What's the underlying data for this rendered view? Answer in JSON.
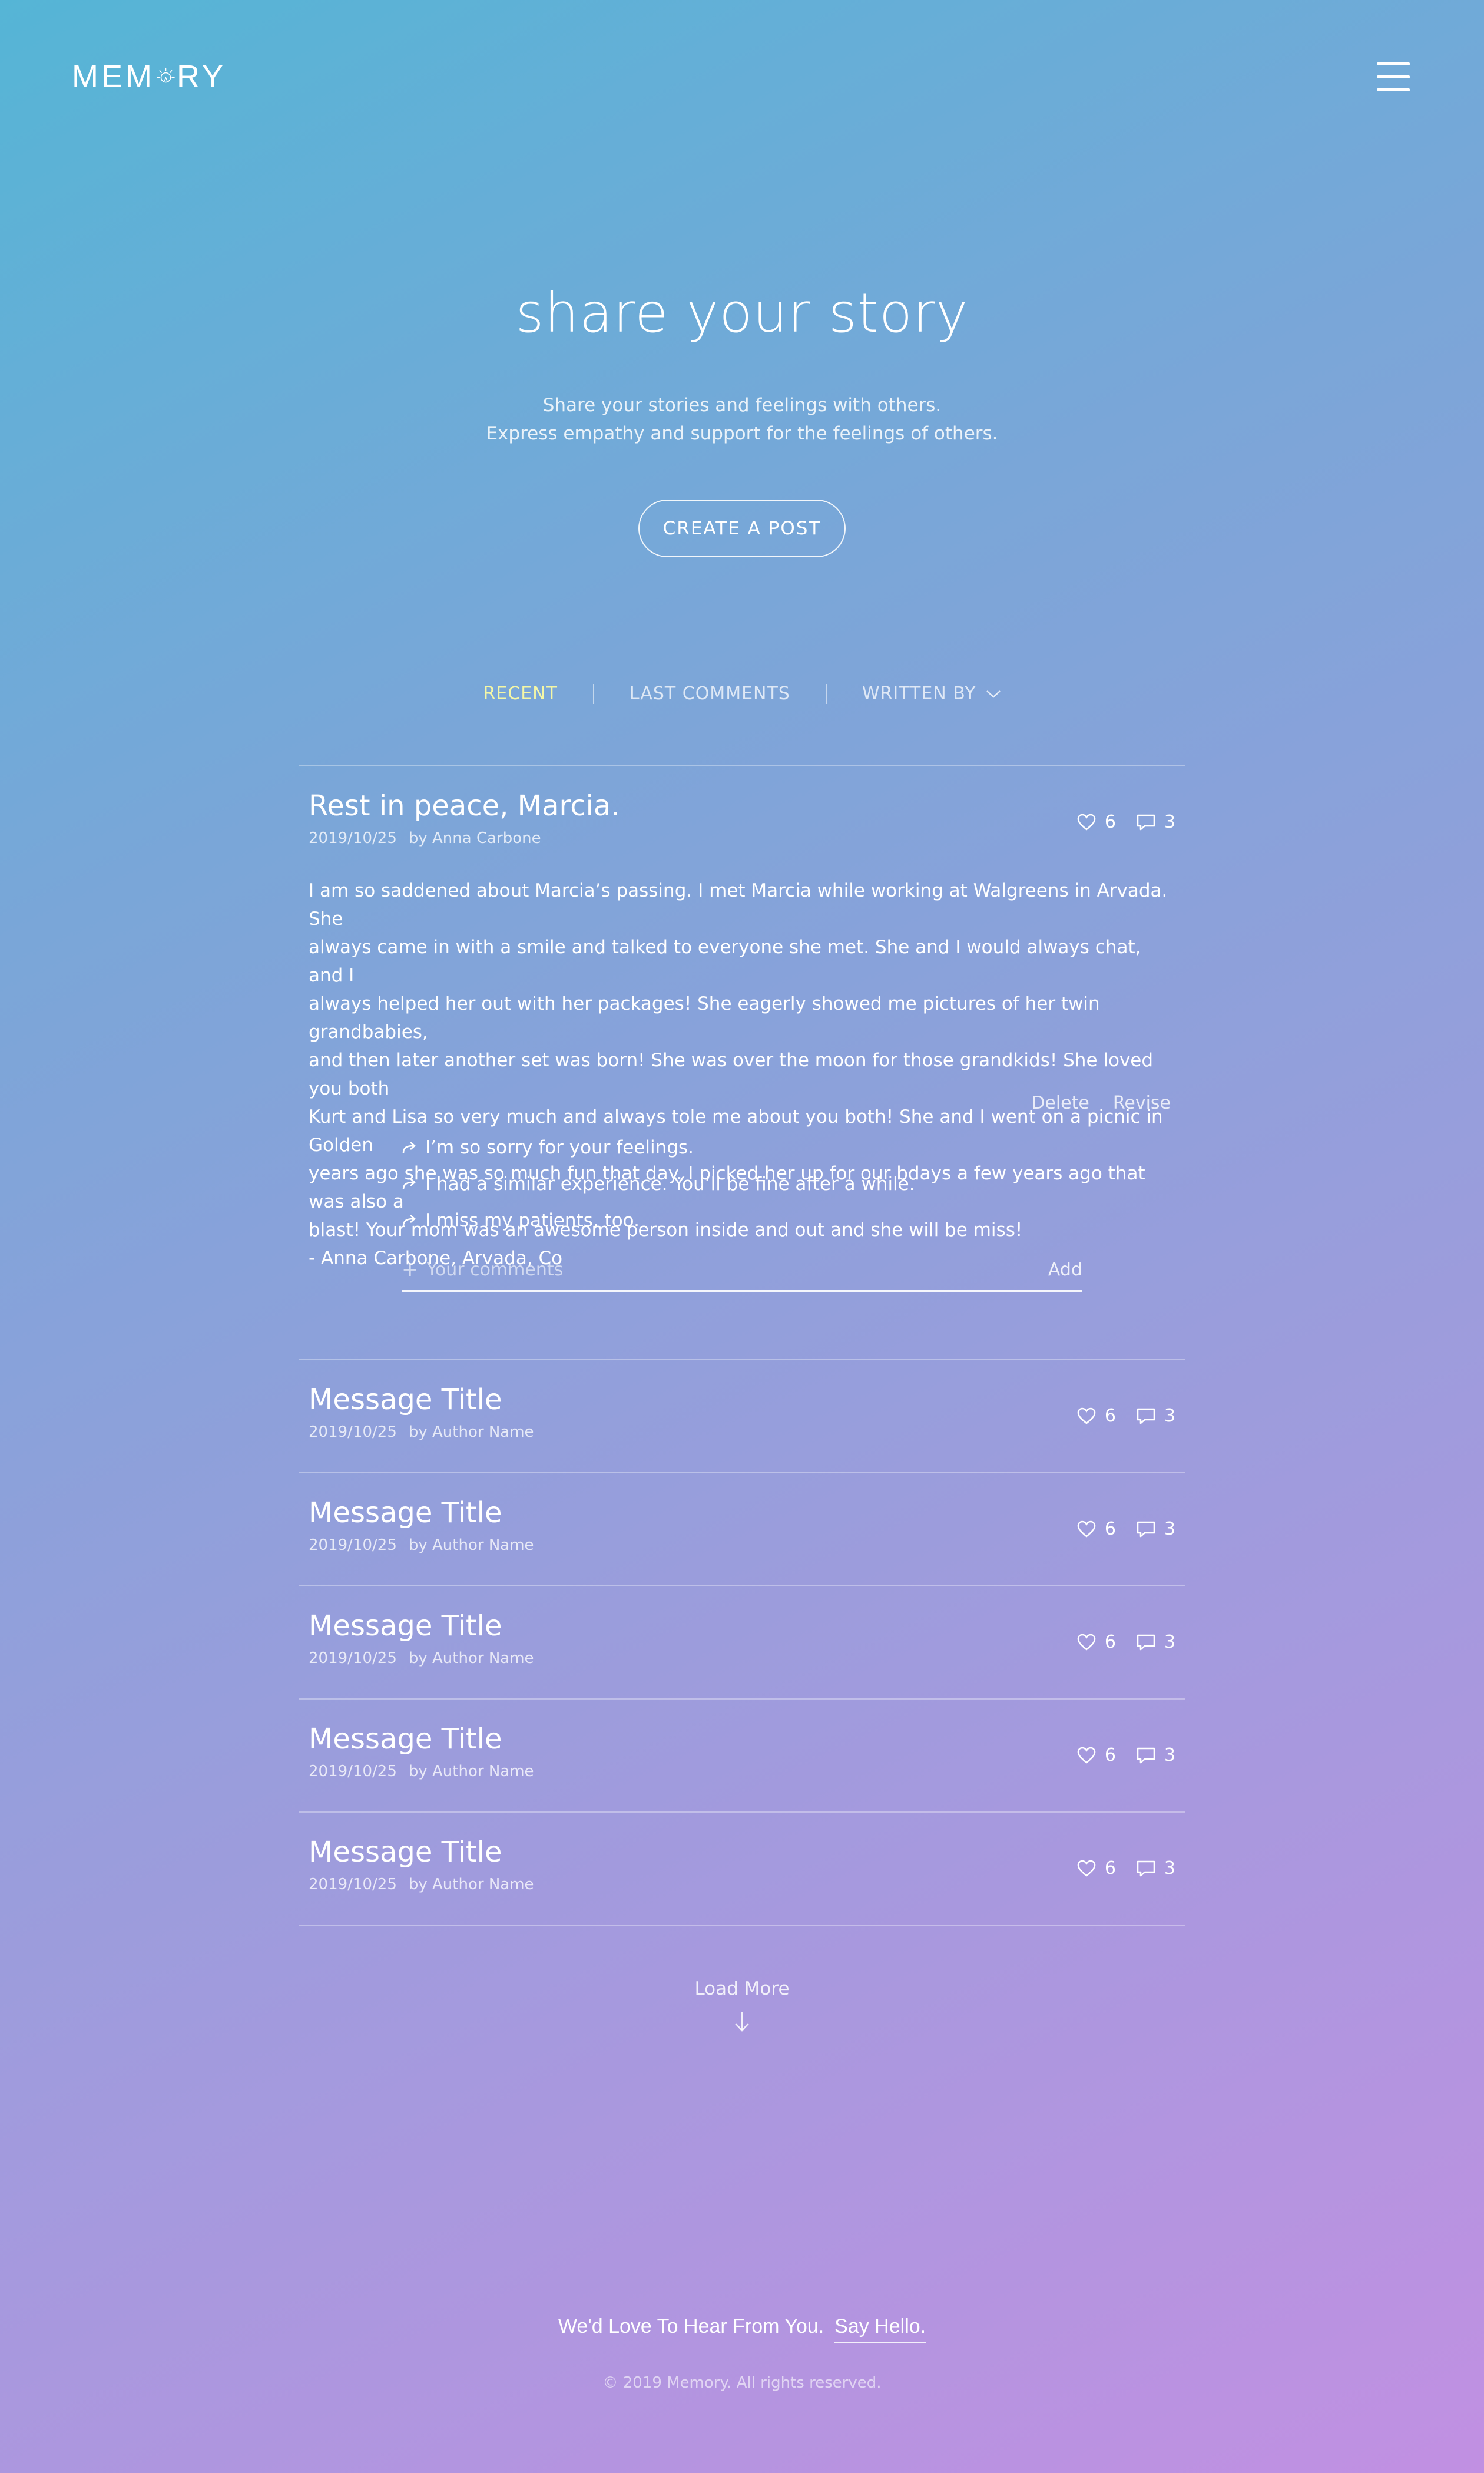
{
  "header": {
    "logo": {
      "pre": "MEM",
      "post": "RY"
    },
    "menu_icon": "hamburger-icon"
  },
  "hero": {
    "title": "share your story",
    "subtitle_line1": "Share your stories and feelings with others.",
    "subtitle_line2": "Express empathy and support for the feelings of others.",
    "cta": "CREATE A POST"
  },
  "filters": {
    "recent": "RECENT",
    "last_comments": "LAST COMMENTS",
    "written_by": "WRITTEN BY",
    "active_color": "#f4f7a6"
  },
  "featured_post": {
    "title": "Rest in peace, Marcia.",
    "date": "2019/10/25",
    "author": "by Anna Carbone",
    "likes": "6",
    "comments_count": "3",
    "body_lines": [
      "I am so saddened about Marcia’s passing. I met Marcia while working at Walgreens in Arvada. She",
      "always came in with a smile and talked to everyone she met. She and I would always chat, and I",
      "always helped her out with her packages! She eagerly showed me pictures of her twin grandbabies,",
      "and then later another set was born! She was over the moon for those grandkids! She loved you both",
      "Kurt and Lisa so very much and always tole me about you both! She and I went on a picnic in Golden",
      "years ago she was so much fun that day. I picked her up for our bdays a few years ago that was also a",
      "blast! Your mom was an awesome person inside and out and she will be miss!",
      "- Anna Carbone, Arvada, Co"
    ],
    "delete": "Delete",
    "revise": "Revise",
    "comments": [
      "I’m so sorry for your feelings.",
      "I had a similar experience. You’ll be fine after a while.",
      "I miss my patients, too."
    ],
    "comment_input": {
      "plus": "+",
      "placeholder": "Your comments",
      "add": "Add"
    }
  },
  "messages": [
    {
      "title": "Message Title",
      "date": "2019/10/25",
      "author": "by Author Name",
      "likes": "6",
      "comments": "3"
    },
    {
      "title": "Message Title",
      "date": "2019/10/25",
      "author": "by Author Name",
      "likes": "6",
      "comments": "3"
    },
    {
      "title": "Message Title",
      "date": "2019/10/25",
      "author": "by Author Name",
      "likes": "6",
      "comments": "3"
    },
    {
      "title": "Message Title",
      "date": "2019/10/25",
      "author": "by Author Name",
      "likes": "6",
      "comments": "3"
    },
    {
      "title": "Message Title",
      "date": "2019/10/25",
      "author": "by Author Name",
      "likes": "6",
      "comments": "3"
    }
  ],
  "load_more": "Load More",
  "footer": {
    "tagline": "We'd Love To Hear From You.",
    "say_hello": "Say Hello.",
    "copyright": "© 2019 Memory. All rights reserved."
  },
  "colors": {
    "gradient_start": "#55b5d6",
    "gradient_end": "#c190e2"
  }
}
